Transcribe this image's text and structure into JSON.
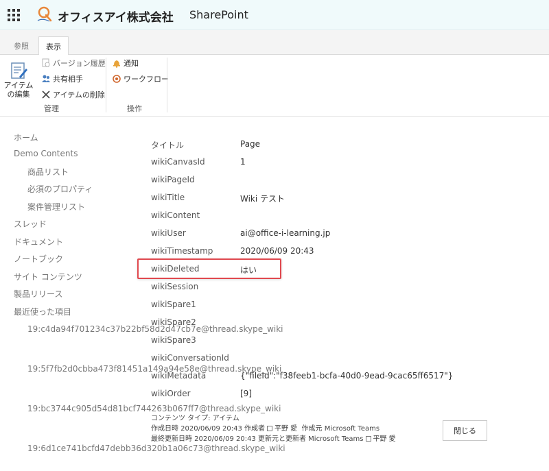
{
  "suitebar": {
    "company": "オフィスアイ株式会社",
    "product": "SharePoint"
  },
  "ribbon": {
    "tabs": [
      {
        "label": "参照"
      },
      {
        "label": "表示"
      }
    ],
    "manage": {
      "edit_item": "アイテムの編集",
      "version_history": "バージョン履歴",
      "shared_with": "共有相手",
      "delete_item": "アイテムの削除",
      "group_label": "管理"
    },
    "actions": {
      "alert_me": "通知",
      "workflows": "ワークフロー",
      "group_label": "操作"
    }
  },
  "nav": {
    "items": [
      {
        "label": "ホーム"
      },
      {
        "label": "Demo Contents"
      },
      {
        "label": "商品リスト"
      },
      {
        "label": "必須のプロパティ"
      },
      {
        "label": "案件管理リスト"
      },
      {
        "label": "スレッド"
      },
      {
        "label": "ドキュメント"
      },
      {
        "label": "ノートブック"
      },
      {
        "label": "サイト コンテンツ"
      },
      {
        "label": "製品リリース"
      },
      {
        "label": "最近使った項目"
      }
    ],
    "recent": [
      {
        "label": "19:c4da94f701234c37b22bf58d2d47cb7e@thread.skype_wiki"
      },
      {
        "label": "19:5f7fb2d0cbba473f81451a149a94e58e@thread.skype_wiki"
      },
      {
        "label": "19:bc3744c905d54d81bcf744263b067ff7@thread.skype_wiki"
      },
      {
        "label": "19:6d1ce741bcfd47debb36d320b1a06c73@thread.skype_wiki"
      }
    ]
  },
  "properties": [
    {
      "key": "タイトル",
      "value": "Page"
    },
    {
      "key": "wikiCanvasId",
      "value": "1"
    },
    {
      "key": "wikiPageId",
      "value": ""
    },
    {
      "key": "wikiTitle",
      "value": "Wiki テスト"
    },
    {
      "key": "wikiContent",
      "value": ""
    },
    {
      "key": "wikiUser",
      "value": "ai@office-i-learning.jp"
    },
    {
      "key": "wikiTimestamp",
      "value": "2020/06/09 20:43"
    },
    {
      "key": "wikiDeleted",
      "value": "はい"
    },
    {
      "key": "wikiSession",
      "value": ""
    },
    {
      "key": "wikiSpare1",
      "value": ""
    },
    {
      "key": "wikiSpare2",
      "value": ""
    },
    {
      "key": "wikiSpare3",
      "value": ""
    },
    {
      "key": "wikiConversationId",
      "value": ""
    },
    {
      "key": "wikiMetadata",
      "value": "{\"fileId\":\"f38feeb1-bcfa-40d0-9ead-9cac65ff6517\"}"
    },
    {
      "key": "wikiOrder",
      "value": "[9]"
    }
  ],
  "footer": {
    "content_type": "コンテンツ タイプ: アイテム",
    "created_prefix": "作成日時 2020/06/09 20:43  作成者",
    "created_by": "平野 愛",
    "created_app": "作成元 Microsoft Teams",
    "modified_prefix": "最終更新日時 2020/06/09 20:43  更新元と更新者 Microsoft Teams",
    "modified_by": "平野 愛",
    "close_label": "閉じる"
  },
  "colors": {
    "highlight_border": "#e0484e",
    "suitebar_bg": "#f0fafb"
  }
}
